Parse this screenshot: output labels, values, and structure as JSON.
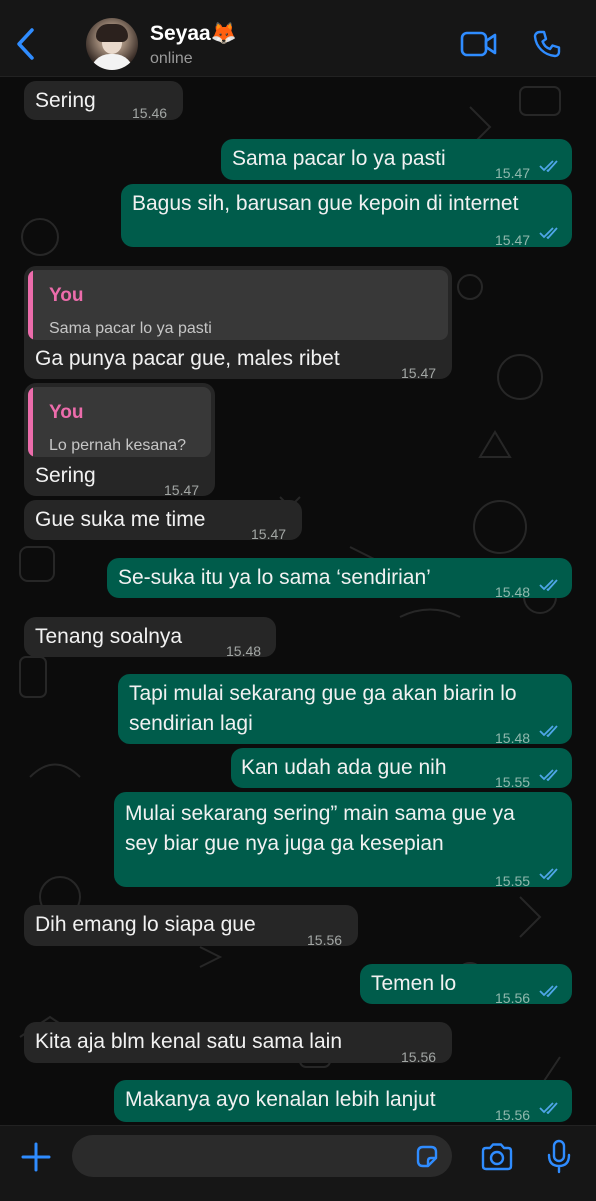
{
  "contact": {
    "name": "Seyaa🦊",
    "status": "online"
  },
  "icons": {
    "back": "chevron-left-icon",
    "video": "video-camera-icon",
    "call": "phone-icon",
    "plus": "plus-icon",
    "sticker": "sticker-icon",
    "camera": "camera-icon",
    "mic": "microphone-icon"
  },
  "colors": {
    "accent": "#2f8cff",
    "outgoing_bubble": "#005c4b",
    "incoming_bubble": "#262626",
    "reply_name": "#ec6cab",
    "read_ticks": "#4fa6e8"
  },
  "messages": [
    {
      "dir": "in",
      "text": "Sering",
      "time": "15.46"
    },
    {
      "dir": "out",
      "text": "Sama pacar lo ya pasti",
      "time": "15.47"
    },
    {
      "dir": "out",
      "text": "Bagus sih, barusan gue kepoin di internet",
      "time": "15.47"
    },
    {
      "dir": "in",
      "reply_to": {
        "who": "You",
        "text": "Sama pacar lo ya pasti"
      },
      "text": "Ga punya pacar gue, males ribet",
      "time": "15.47"
    },
    {
      "dir": "in",
      "reply_to": {
        "who": "You",
        "text": "Lo pernah kesana?"
      },
      "text": "Sering",
      "time": "15.47"
    },
    {
      "dir": "in",
      "text": "Gue suka me time",
      "time": "15.47"
    },
    {
      "dir": "out",
      "text": "Se-suka itu ya lo sama ‘sendirian’",
      "time": "15.48"
    },
    {
      "dir": "in",
      "text": "Tenang soalnya",
      "time": "15.48"
    },
    {
      "dir": "out",
      "lines": [
        "Tapi mulai sekarang gue ga akan biarin lo",
        "sendirian lagi"
      ],
      "time": "15.48"
    },
    {
      "dir": "out",
      "text": "Kan udah ada gue nih",
      "time": "15.55"
    },
    {
      "dir": "out",
      "lines": [
        "Mulai sekarang sering” main sama gue ya",
        "sey biar gue nya juga ga kesepian"
      ],
      "time": "15.55"
    },
    {
      "dir": "in",
      "text": "Dih emang lo siapa gue",
      "time": "15.56"
    },
    {
      "dir": "out",
      "text": "Temen lo",
      "time": "15.56"
    },
    {
      "dir": "in",
      "text": "Kita aja blm kenal satu sama lain",
      "time": "15.56"
    },
    {
      "dir": "out",
      "text": "Makanya ayo kenalan lebih lanjut",
      "time": "15.56"
    }
  ],
  "composer": {
    "placeholder": ""
  }
}
